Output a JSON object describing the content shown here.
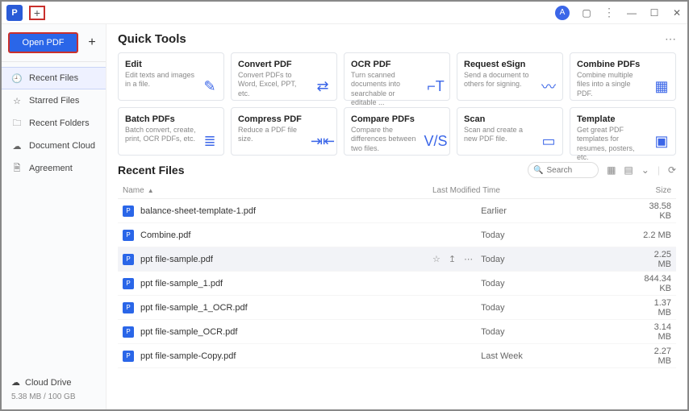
{
  "titlebar": {
    "new_tab": "+",
    "avatar_initial": "A"
  },
  "sidebar": {
    "open_pdf": "Open PDF",
    "items": [
      {
        "icon": "clock",
        "label": "Recent Files",
        "active": true
      },
      {
        "icon": "star",
        "label": "Starred Files",
        "active": false
      },
      {
        "icon": "folder",
        "label": "Recent Folders",
        "active": false
      },
      {
        "icon": "cloud",
        "label": "Document Cloud",
        "active": false
      },
      {
        "icon": "doc",
        "label": "Agreement",
        "active": false
      }
    ],
    "cloud_drive": "Cloud Drive",
    "cloud_stat": "5.38 MB / 100 GB"
  },
  "quick_tools": {
    "title": "Quick Tools",
    "cards": [
      {
        "title": "Edit",
        "desc": "Edit texts and images in a file.",
        "icon": "edit"
      },
      {
        "title": "Convert PDF",
        "desc": "Convert PDFs to Word, Excel, PPT, etc.",
        "icon": "convert"
      },
      {
        "title": "OCR PDF",
        "desc": "Turn scanned documents into searchable or editable ...",
        "icon": "ocr"
      },
      {
        "title": "Request eSign",
        "desc": "Send a document to others for signing.",
        "icon": "esign"
      },
      {
        "title": "Combine PDFs",
        "desc": "Combine multiple files into a single PDF.",
        "icon": "combine"
      },
      {
        "title": "Batch PDFs",
        "desc": "Batch convert, create, print, OCR PDFs, etc.",
        "icon": "batch"
      },
      {
        "title": "Compress PDF",
        "desc": "Reduce a PDF file size.",
        "icon": "compress"
      },
      {
        "title": "Compare PDFs",
        "desc": "Compare the differences between two files.",
        "icon": "compare"
      },
      {
        "title": "Scan",
        "desc": "Scan and create a new PDF file.",
        "icon": "scan"
      },
      {
        "title": "Template",
        "desc": "Get great PDF templates for resumes, posters, etc.",
        "icon": "template"
      }
    ]
  },
  "recent": {
    "title": "Recent Files",
    "search_placeholder": "Search",
    "columns": {
      "name": "Name",
      "mod": "Last Modified Time",
      "size": "Size"
    },
    "files": [
      {
        "name": "balance-sheet-template-1.pdf",
        "mod": "Earlier",
        "size": "38.58 KB",
        "hl": false
      },
      {
        "name": "Combine.pdf",
        "mod": "Today",
        "size": "2.2 MB",
        "hl": false
      },
      {
        "name": "ppt file-sample.pdf",
        "mod": "Today",
        "size": "2.25 MB",
        "hl": true
      },
      {
        "name": "ppt file-sample_1.pdf",
        "mod": "Today",
        "size": "844.34 KB",
        "hl": false
      },
      {
        "name": "ppt file-sample_1_OCR.pdf",
        "mod": "Today",
        "size": "1.37 MB",
        "hl": false
      },
      {
        "name": "ppt file-sample_OCR.pdf",
        "mod": "Today",
        "size": "3.14 MB",
        "hl": false
      },
      {
        "name": "ppt file-sample-Copy.pdf",
        "mod": "Last Week",
        "size": "2.27 MB",
        "hl": false
      }
    ]
  }
}
